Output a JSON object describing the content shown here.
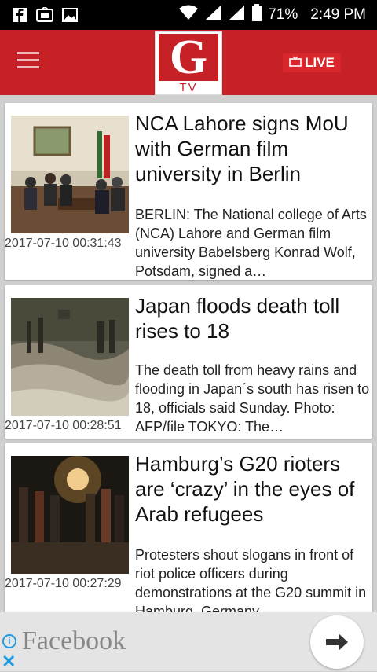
{
  "status_bar": {
    "battery": "71%",
    "time": "2:49 PM"
  },
  "app_bar": {
    "logo_letter": "G",
    "logo_sub": "TV",
    "live_label": "LIVE",
    "brand_color": "#c62127"
  },
  "articles": [
    {
      "title": "NCA Lahore signs MoU with German film university in Berlin",
      "date": "2017-07-10 00:31:43",
      "excerpt": "BERLIN: The National college of Arts (NCA) Lahore and German film university Babelsberg Konrad Wolf, Potsdam, signed a…"
    },
    {
      "title": "Japan floods death toll rises to 18",
      "date": "2017-07-10 00:28:51",
      "excerpt": "The death toll from heavy rains and flooding in Japan´s south has risen to 18, officials said Sunday. Photo: AFP/file   TOKYO: The…"
    },
    {
      "title": "Hamburg’s G20 rioters are ‘crazy’ in the eyes of Arab refugees",
      "date": "2017-07-10 00:27:29",
      "excerpt": "Protesters shout slogans in front of riot police officers during demonstrations at the G20 summit in Hamburg, Germany"
    }
  ],
  "ad": {
    "text": "Facebook",
    "info_icon": "i",
    "close_icon": "✕"
  }
}
